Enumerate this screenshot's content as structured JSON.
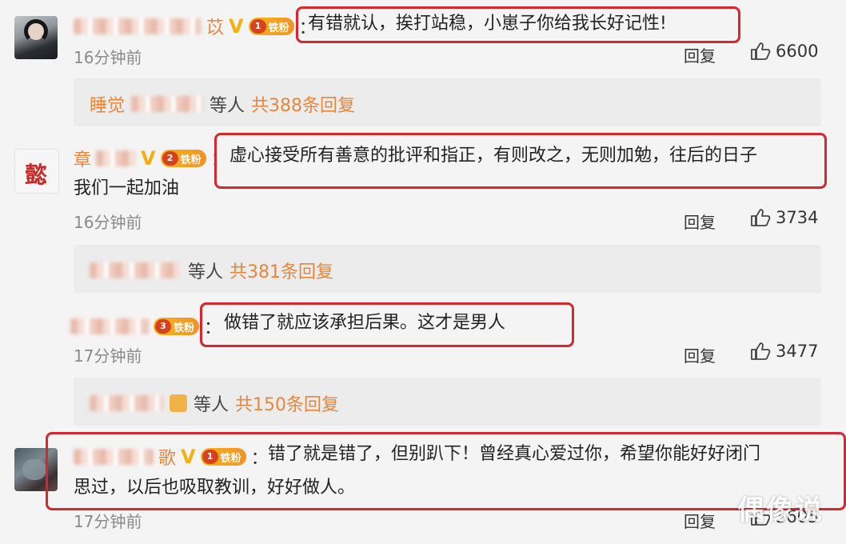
{
  "comments": [
    {
      "name_suffix": "苡",
      "text_line1": "有错就认，挨打站稳，小崽子你给我长好记性!",
      "text_line2": "",
      "time": "16分钟前",
      "reply_label": "回复",
      "likes": "6600",
      "fan_badge": "铁粉",
      "fan_level": "1",
      "verified": "V",
      "subreplies": {
        "others_label": "等人",
        "count_label": "共388条回复",
        "name_prefix": "睡觉"
      }
    },
    {
      "name_suffix": "章",
      "text_line1": "虚心接受所有善意的批评和指正，有则改之，无则加勉，往后的日子",
      "text_line2": "我们一起加油",
      "time": "16分钟前",
      "reply_label": "回复",
      "likes": "3734",
      "fan_badge": "铁粉",
      "fan_level": "2",
      "verified": "V",
      "subreplies": {
        "others_label": "等人",
        "count_label": "共381条回复",
        "name_prefix": ""
      }
    },
    {
      "name_suffix": "",
      "text_line1": "做错了就应该承担后果。这才是男人",
      "text_line2": "",
      "time": "17分钟前",
      "reply_label": "回复",
      "likes": "3477",
      "fan_badge": "铁粉",
      "fan_level": "3",
      "verified": "",
      "subreplies": {
        "others_label": "等人",
        "count_label": "共150条回复",
        "name_prefix": ""
      }
    },
    {
      "name_suffix": "歌",
      "text_line1": "错了就是错了，但别趴下！曾经真心爱过你，希望你能好好闭门",
      "text_line2": "思过，以后也吸取教训，好好做人。",
      "time": "17分钟前",
      "reply_label": "回复",
      "likes": "3605",
      "fan_badge": "铁粉",
      "fan_level": "1",
      "verified": "V",
      "subreplies": null
    }
  ],
  "colon": "：",
  "watermark": "偶像说",
  "colors": {
    "accent_orange": "#e8863c",
    "highlight_red": "#d8262f",
    "badge_gold": "#f4b012"
  }
}
